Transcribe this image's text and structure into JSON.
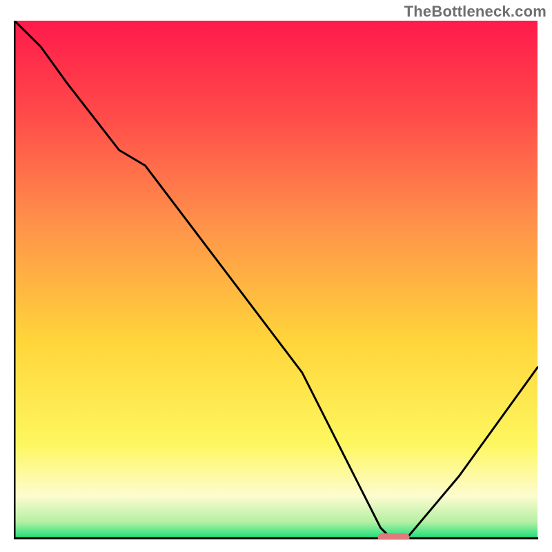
{
  "watermark": "TheBottleneck.com",
  "colors": {
    "gradient_top": "#ff1a4b",
    "gradient_mid1": "#ff7a3d",
    "gradient_mid2": "#ffd53a",
    "gradient_low": "#fdfccf",
    "gradient_bottom": "#1fe07a",
    "curve": "#000000",
    "axis": "#000000",
    "marker": "#e17a7d",
    "watermark_color": "#6f6f6f"
  },
  "chart_data": {
    "type": "line",
    "title": "",
    "xlabel": "",
    "ylabel": "",
    "x": [
      0,
      5,
      10,
      20,
      25,
      40,
      55,
      65,
      70,
      72,
      75,
      85,
      100
    ],
    "values": [
      100,
      95,
      88,
      75,
      72,
      52,
      32,
      12,
      2,
      0,
      0,
      12,
      33
    ],
    "xlim": [
      0,
      100
    ],
    "ylim": [
      0,
      100
    ],
    "marker": {
      "x_start": 70,
      "x_end": 75,
      "y": 0
    },
    "background": "vertical heat gradient red→orange→yellow→green"
  }
}
